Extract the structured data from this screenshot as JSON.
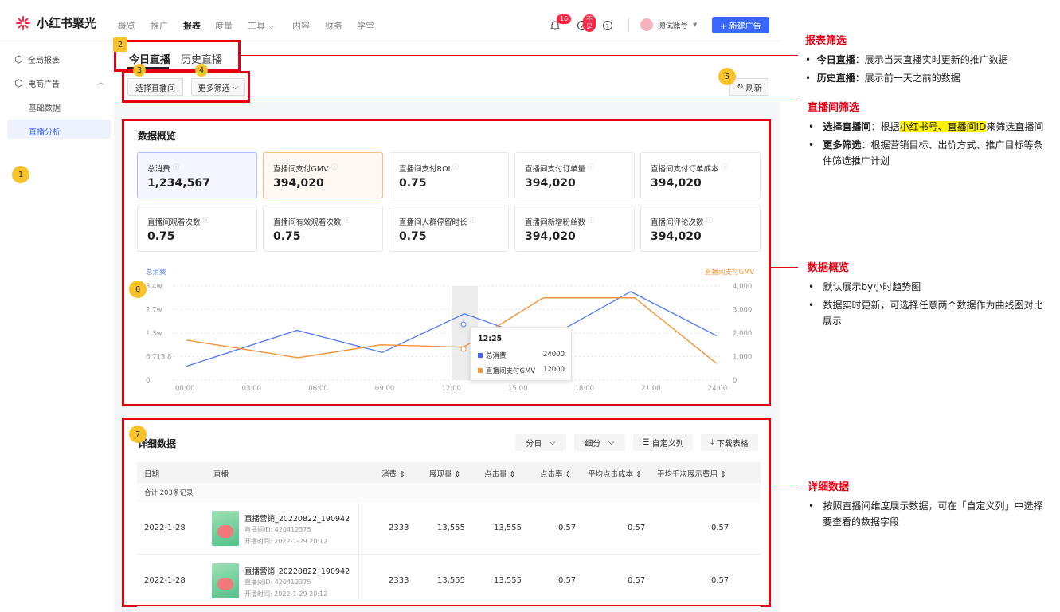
{
  "nav": {
    "brand": "小红书聚光",
    "items": [
      "概览",
      "推广",
      "报表",
      "度量",
      "工具",
      "内容",
      "财务",
      "学堂"
    ],
    "active_index": 2,
    "notif_count": "16",
    "wallet_badge": "不足",
    "account": "测试账号",
    "new_ad": "+ 新建广告"
  },
  "sidebar": {
    "items": [
      {
        "label": "全局报表"
      },
      {
        "label": "电商广告"
      }
    ],
    "sub": [
      "基础数据",
      "直播分析"
    ],
    "active": "直播分析"
  },
  "markers": [
    "1",
    "2",
    "3",
    "4",
    "5",
    "6",
    "7"
  ],
  "tabs": [
    "今日直播",
    "历史直播"
  ],
  "filters": {
    "select_room": "选择直播间",
    "more": "更多筛选",
    "refresh": "刷新"
  },
  "overview": {
    "title": "数据概览",
    "metrics": [
      {
        "label": "总消费",
        "value": "1,234,567"
      },
      {
        "label": "直播间支付GMV",
        "value": "394,020"
      },
      {
        "label": "直播间支付ROI",
        "value": "0.75"
      },
      {
        "label": "直播间支付订单量",
        "value": "394,020"
      },
      {
        "label": "直播间支付订单成本",
        "value": "394,020"
      },
      {
        "label": "直播间观看次数",
        "value": "0.75"
      },
      {
        "label": "直播间有效观看次数",
        "value": "0.75"
      },
      {
        "label": "直播间人群停留时长",
        "value": "0.75"
      },
      {
        "label": "直播间新增粉丝数",
        "value": "394,020"
      },
      {
        "label": "直播间评论次数",
        "value": "394,020"
      }
    ]
  },
  "chart_data": {
    "type": "line",
    "x": [
      "00:00",
      "03:00",
      "06:00",
      "09:00",
      "12:00",
      "15:00",
      "18:00",
      "21:00",
      "24:00"
    ],
    "left_label": "总消费",
    "right_label": "直播间支付GMV",
    "left_ticks": [
      "3.4w",
      "2.7w",
      "1.3w",
      "6,713.8",
      "0"
    ],
    "right_ticks": [
      "4,000",
      "3,000",
      "2,000",
      "1,000",
      "0"
    ],
    "series": [
      {
        "name": "总消费",
        "color": "#5b82f5",
        "axis": "left",
        "values": [
          5000,
          18000,
          10000,
          24000,
          14000,
          32000,
          16000
        ]
      },
      {
        "name": "直播间支付GMV",
        "color": "#f5943a",
        "axis": "right",
        "values": [
          1700,
          950,
          1500,
          1400,
          3500,
          3500,
          700
        ]
      }
    ],
    "tooltip": {
      "time": "12:25",
      "rows": [
        {
          "name": "总消费",
          "value": "24000"
        },
        {
          "name": "直播间支付GMV",
          "value": "12000"
        }
      ]
    }
  },
  "detail": {
    "title": "详细数据",
    "by_day": "分日",
    "breakdown": "细分",
    "custom": "自定义列",
    "download": "下载表格",
    "columns": [
      "日期",
      "直播",
      "消费 ⇕",
      "展现量 ⇕",
      "点击量 ⇕",
      "点击率 ⇕",
      "平均点击成本 ⇕",
      "平均千次展示费用 ⇕"
    ],
    "total": "合计 203条记录",
    "rows": [
      {
        "date": "2022-1-28",
        "name": "直播营销_20220822_190942",
        "id": "直播间ID: 420412375",
        "time": "开播时间: 2022-1-29 20:12",
        "cost": "2333",
        "imp": "13,555",
        "click": "13,555",
        "ctr": "0.57",
        "cpc": "0.57",
        "cpm": "0.57"
      },
      {
        "date": "2022-1-28",
        "name": "直播营销_20220822_190942",
        "id": "直播间ID: 420412375",
        "time": "开播时间: 2022-1-29 20:12",
        "cost": "2333",
        "imp": "13,555",
        "click": "13,555",
        "ctr": "0.57",
        "cpc": "0.57",
        "cpm": "0.57"
      }
    ]
  },
  "annotations": [
    {
      "title": "报表筛选",
      "items": [
        {
          "b": "今日直播",
          "t": "：展示当天直播实时更新的推广数据"
        },
        {
          "b": "历史直播",
          "t": "：展示前一天之前的数据"
        }
      ]
    },
    {
      "title": "直播间筛选",
      "items": [
        {
          "b": "选择直播间",
          "t1": "：根据",
          "hl": "小红书号、直播间ID",
          "t2": "来筛选直播间"
        },
        {
          "b": "更多筛选",
          "t": "：根据营销目标、出价方式、推广目标等条件筛选推广计划"
        }
      ]
    },
    {
      "title": "数据概览",
      "items": [
        {
          "t": "默认展示by小时趋势图"
        },
        {
          "t": "数据实时更新，可选择任意两个数据作为曲线图对比展示"
        }
      ]
    },
    {
      "title": "详细数据",
      "items": [
        {
          "t": "按照直播间维度展示数据，可在「自定义列」中选择要查看的数据字段"
        }
      ]
    }
  ]
}
